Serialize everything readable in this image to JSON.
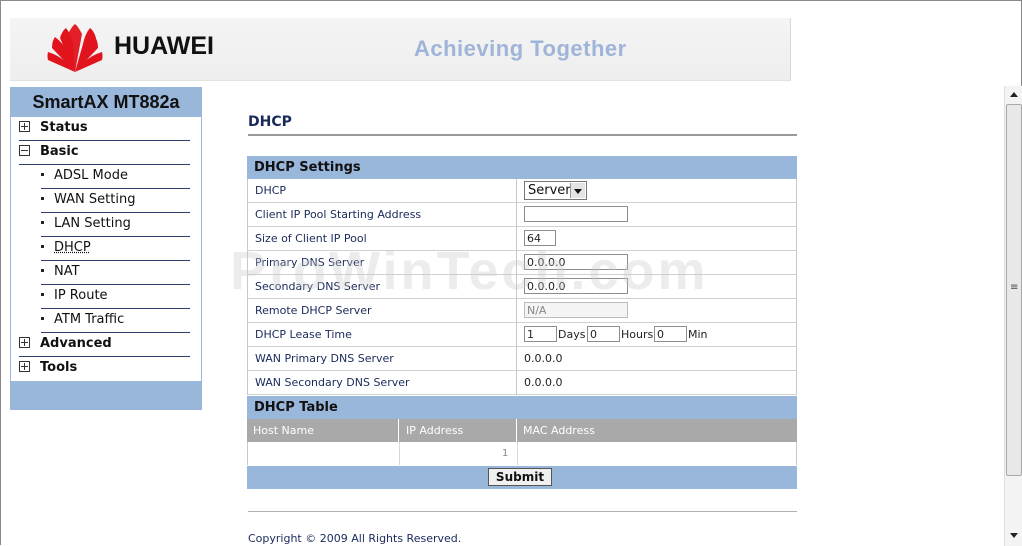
{
  "header": {
    "brand": "HUAWEI",
    "slogan": "Achieving Together",
    "logo_color": "#e1141e"
  },
  "nav": {
    "title": "SmartAX MT882a",
    "items": [
      {
        "label": "Status",
        "icon": "plus-box-icon"
      },
      {
        "label": "Basic",
        "icon": "minus-box-icon"
      },
      {
        "label": "ADSL Mode"
      },
      {
        "label": "WAN Setting"
      },
      {
        "label": "LAN Setting"
      },
      {
        "label": "DHCP",
        "active": true
      },
      {
        "label": "NAT"
      },
      {
        "label": "IP Route"
      },
      {
        "label": "ATM Traffic"
      },
      {
        "label": "Advanced",
        "icon": "plus-box-icon"
      },
      {
        "label": "Tools",
        "icon": "plus-box-icon"
      }
    ]
  },
  "page": {
    "title": "DHCP",
    "settings_header": "DHCP Settings",
    "dhcp_label": "DHCP",
    "dhcp_value": "Server",
    "pool_start_label": "Client IP Pool Starting Address",
    "pool_start_value": "",
    "pool_size_label": "Size of Client IP Pool",
    "pool_size_value": "64",
    "primary_dns_label": "Primary DNS Server",
    "primary_dns_value": "0.0.0.0",
    "secondary_dns_label": "Secondary DNS Server",
    "secondary_dns_value": "0.0.0.0",
    "remote_dhcp_label": "Remote DHCP Server",
    "remote_dhcp_value": "N/A",
    "lease_label": "DHCP Lease Time",
    "lease_days": "1",
    "lease_days_unit": "Days",
    "lease_hours": "0",
    "lease_hours_unit": "Hours",
    "lease_min": "0",
    "lease_min_unit": "Min",
    "wan_primary_label": "WAN Primary DNS Server",
    "wan_primary_value": "0.0.0.0",
    "wan_secondary_label": "WAN Secondary DNS Server",
    "wan_secondary_value": "0.0.0.0",
    "table_header": "DHCP Table",
    "table_columns": [
      "Host Name",
      "IP Address",
      "MAC Address"
    ],
    "table_row": [
      "",
      "1",
      ""
    ],
    "submit_label": "Submit",
    "copyright": "Copyright © 2009 All Rights Reserved.",
    "watermark": "ProWinTech.com"
  }
}
